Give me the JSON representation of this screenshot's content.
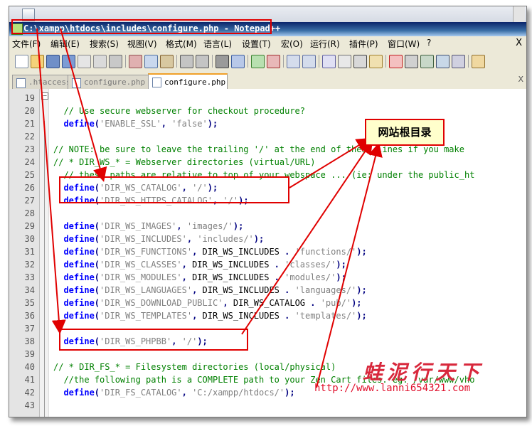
{
  "window": {
    "title": "C:\\xampp\\htdocs\\includes\\configure.php - Notepad++"
  },
  "menu": [
    "文件(F)",
    "编辑(E)",
    "搜索(S)",
    "视图(V)",
    "格式(M)",
    "语言(L)",
    "设置(T)",
    "宏(O)",
    "运行(R)",
    "插件(P)",
    "窗口(W)",
    "?"
  ],
  "menu_close": "X",
  "tabs": [
    {
      "label": ".htaccess",
      "active": false
    },
    {
      "label": "configure.php",
      "active": false
    },
    {
      "label": "configure.php",
      "active": true
    }
  ],
  "tab_close": "X",
  "editor": {
    "lines": [
      {
        "num": "19",
        "seg": []
      },
      {
        "num": "20",
        "seg": [
          [
            "cm",
            "  // Use secure webserver for checkout procedure?"
          ]
        ]
      },
      {
        "num": "21",
        "seg": [
          [
            "kw",
            "  define"
          ],
          [
            "op",
            "("
          ],
          [
            "st",
            "'ENABLE_SSL'"
          ],
          [
            "op",
            ", "
          ],
          [
            "st",
            "'false'"
          ],
          [
            "op",
            ");"
          ]
        ]
      },
      {
        "num": "22",
        "seg": []
      },
      {
        "num": "23",
        "seg": [
          [
            "cm",
            "// NOTE: be sure to leave the trailing '/' at the end of these lines if you make"
          ]
        ]
      },
      {
        "num": "24",
        "seg": [
          [
            "cm",
            "// * DIR_WS_* = Webserver directories (virtual/URL)"
          ]
        ]
      },
      {
        "num": "25",
        "seg": [
          [
            "cm",
            "  // these paths are relative to top of your webspace ... (ie: under the public_ht"
          ]
        ]
      },
      {
        "num": "26",
        "seg": [
          [
            "kw",
            "  define"
          ],
          [
            "op",
            "("
          ],
          [
            "st",
            "'DIR_WS_CATALOG'"
          ],
          [
            "op",
            ", "
          ],
          [
            "st",
            "'/'"
          ],
          [
            "op",
            ");"
          ]
        ]
      },
      {
        "num": "27",
        "seg": [
          [
            "kw",
            "  define"
          ],
          [
            "op",
            "("
          ],
          [
            "st",
            "'DIR_WS_HTTPS_CATALOG'"
          ],
          [
            "op",
            ", "
          ],
          [
            "st",
            "'/'"
          ],
          [
            "op",
            ");"
          ]
        ]
      },
      {
        "num": "28",
        "seg": []
      },
      {
        "num": "29",
        "seg": [
          [
            "kw",
            "  define"
          ],
          [
            "op",
            "("
          ],
          [
            "st",
            "'DIR_WS_IMAGES'"
          ],
          [
            "op",
            ", "
          ],
          [
            "st",
            "'images/'"
          ],
          [
            "op",
            ");"
          ]
        ]
      },
      {
        "num": "30",
        "seg": [
          [
            "kw",
            "  define"
          ],
          [
            "op",
            "("
          ],
          [
            "st",
            "'DIR_WS_INCLUDES'"
          ],
          [
            "op",
            ", "
          ],
          [
            "st",
            "'includes/'"
          ],
          [
            "op",
            ");"
          ]
        ]
      },
      {
        "num": "31",
        "seg": [
          [
            "kw",
            "  define"
          ],
          [
            "op",
            "("
          ],
          [
            "st",
            "'DIR_WS_FUNCTIONS'"
          ],
          [
            "op",
            ", "
          ],
          [
            "id",
            "DIR_WS_INCLUDES "
          ],
          [
            "op",
            ". "
          ],
          [
            "st",
            "'functions/'"
          ],
          [
            "op",
            ");"
          ]
        ]
      },
      {
        "num": "32",
        "seg": [
          [
            "kw",
            "  define"
          ],
          [
            "op",
            "("
          ],
          [
            "st",
            "'DIR_WS_CLASSES'"
          ],
          [
            "op",
            ", "
          ],
          [
            "id",
            "DIR_WS_INCLUDES "
          ],
          [
            "op",
            ". "
          ],
          [
            "st",
            "'classes/'"
          ],
          [
            "op",
            ");"
          ]
        ]
      },
      {
        "num": "33",
        "seg": [
          [
            "kw",
            "  define"
          ],
          [
            "op",
            "("
          ],
          [
            "st",
            "'DIR_WS_MODULES'"
          ],
          [
            "op",
            ", "
          ],
          [
            "id",
            "DIR_WS_INCLUDES "
          ],
          [
            "op",
            ". "
          ],
          [
            "st",
            "'modules/'"
          ],
          [
            "op",
            ");"
          ]
        ]
      },
      {
        "num": "34",
        "seg": [
          [
            "kw",
            "  define"
          ],
          [
            "op",
            "("
          ],
          [
            "st",
            "'DIR_WS_LANGUAGES'"
          ],
          [
            "op",
            ", "
          ],
          [
            "id",
            "DIR_WS_INCLUDES "
          ],
          [
            "op",
            ". "
          ],
          [
            "st",
            "'languages/'"
          ],
          [
            "op",
            ");"
          ]
        ]
      },
      {
        "num": "35",
        "seg": [
          [
            "kw",
            "  define"
          ],
          [
            "op",
            "("
          ],
          [
            "st",
            "'DIR_WS_DOWNLOAD_PUBLIC'"
          ],
          [
            "op",
            ", "
          ],
          [
            "id",
            "DIR_WS_CATALOG "
          ],
          [
            "op",
            ". "
          ],
          [
            "st",
            "'pub/'"
          ],
          [
            "op",
            ");"
          ]
        ]
      },
      {
        "num": "36",
        "seg": [
          [
            "kw",
            "  define"
          ],
          [
            "op",
            "("
          ],
          [
            "st",
            "'DIR_WS_TEMPLATES'"
          ],
          [
            "op",
            ", "
          ],
          [
            "id",
            "DIR_WS_INCLUDES "
          ],
          [
            "op",
            ". "
          ],
          [
            "st",
            "'templates/'"
          ],
          [
            "op",
            ");"
          ]
        ]
      },
      {
        "num": "37",
        "seg": []
      },
      {
        "num": "38",
        "seg": [
          [
            "kw",
            "  define"
          ],
          [
            "op",
            "("
          ],
          [
            "st",
            "'DIR_WS_PHPBB'"
          ],
          [
            "op",
            ", "
          ],
          [
            "st",
            "'/'"
          ],
          [
            "op",
            ");"
          ]
        ]
      },
      {
        "num": "39",
        "seg": []
      },
      {
        "num": "40",
        "seg": [
          [
            "cm",
            "// * DIR_FS_* = Filesystem directories (local/physical)"
          ]
        ]
      },
      {
        "num": "41",
        "seg": [
          [
            "cm",
            "  //the following path is a COMPLETE path to your Zen Cart files. eg: /var/www/vho"
          ]
        ]
      },
      {
        "num": "42",
        "seg": [
          [
            "kw",
            "  define"
          ],
          [
            "op",
            "("
          ],
          [
            "st",
            "'DIR_FS_CATALOG'"
          ],
          [
            "op",
            ", "
          ],
          [
            "st",
            "'C:/xampp/htdocs/'"
          ],
          [
            "op",
            ");"
          ]
        ]
      },
      {
        "num": "43",
        "seg": []
      }
    ]
  },
  "annotations": {
    "callout": "网站根目录",
    "watermark_cn": "蛙泥行天下",
    "watermark_url": "http://www.lanni654321.com",
    "color": "#e00000"
  }
}
